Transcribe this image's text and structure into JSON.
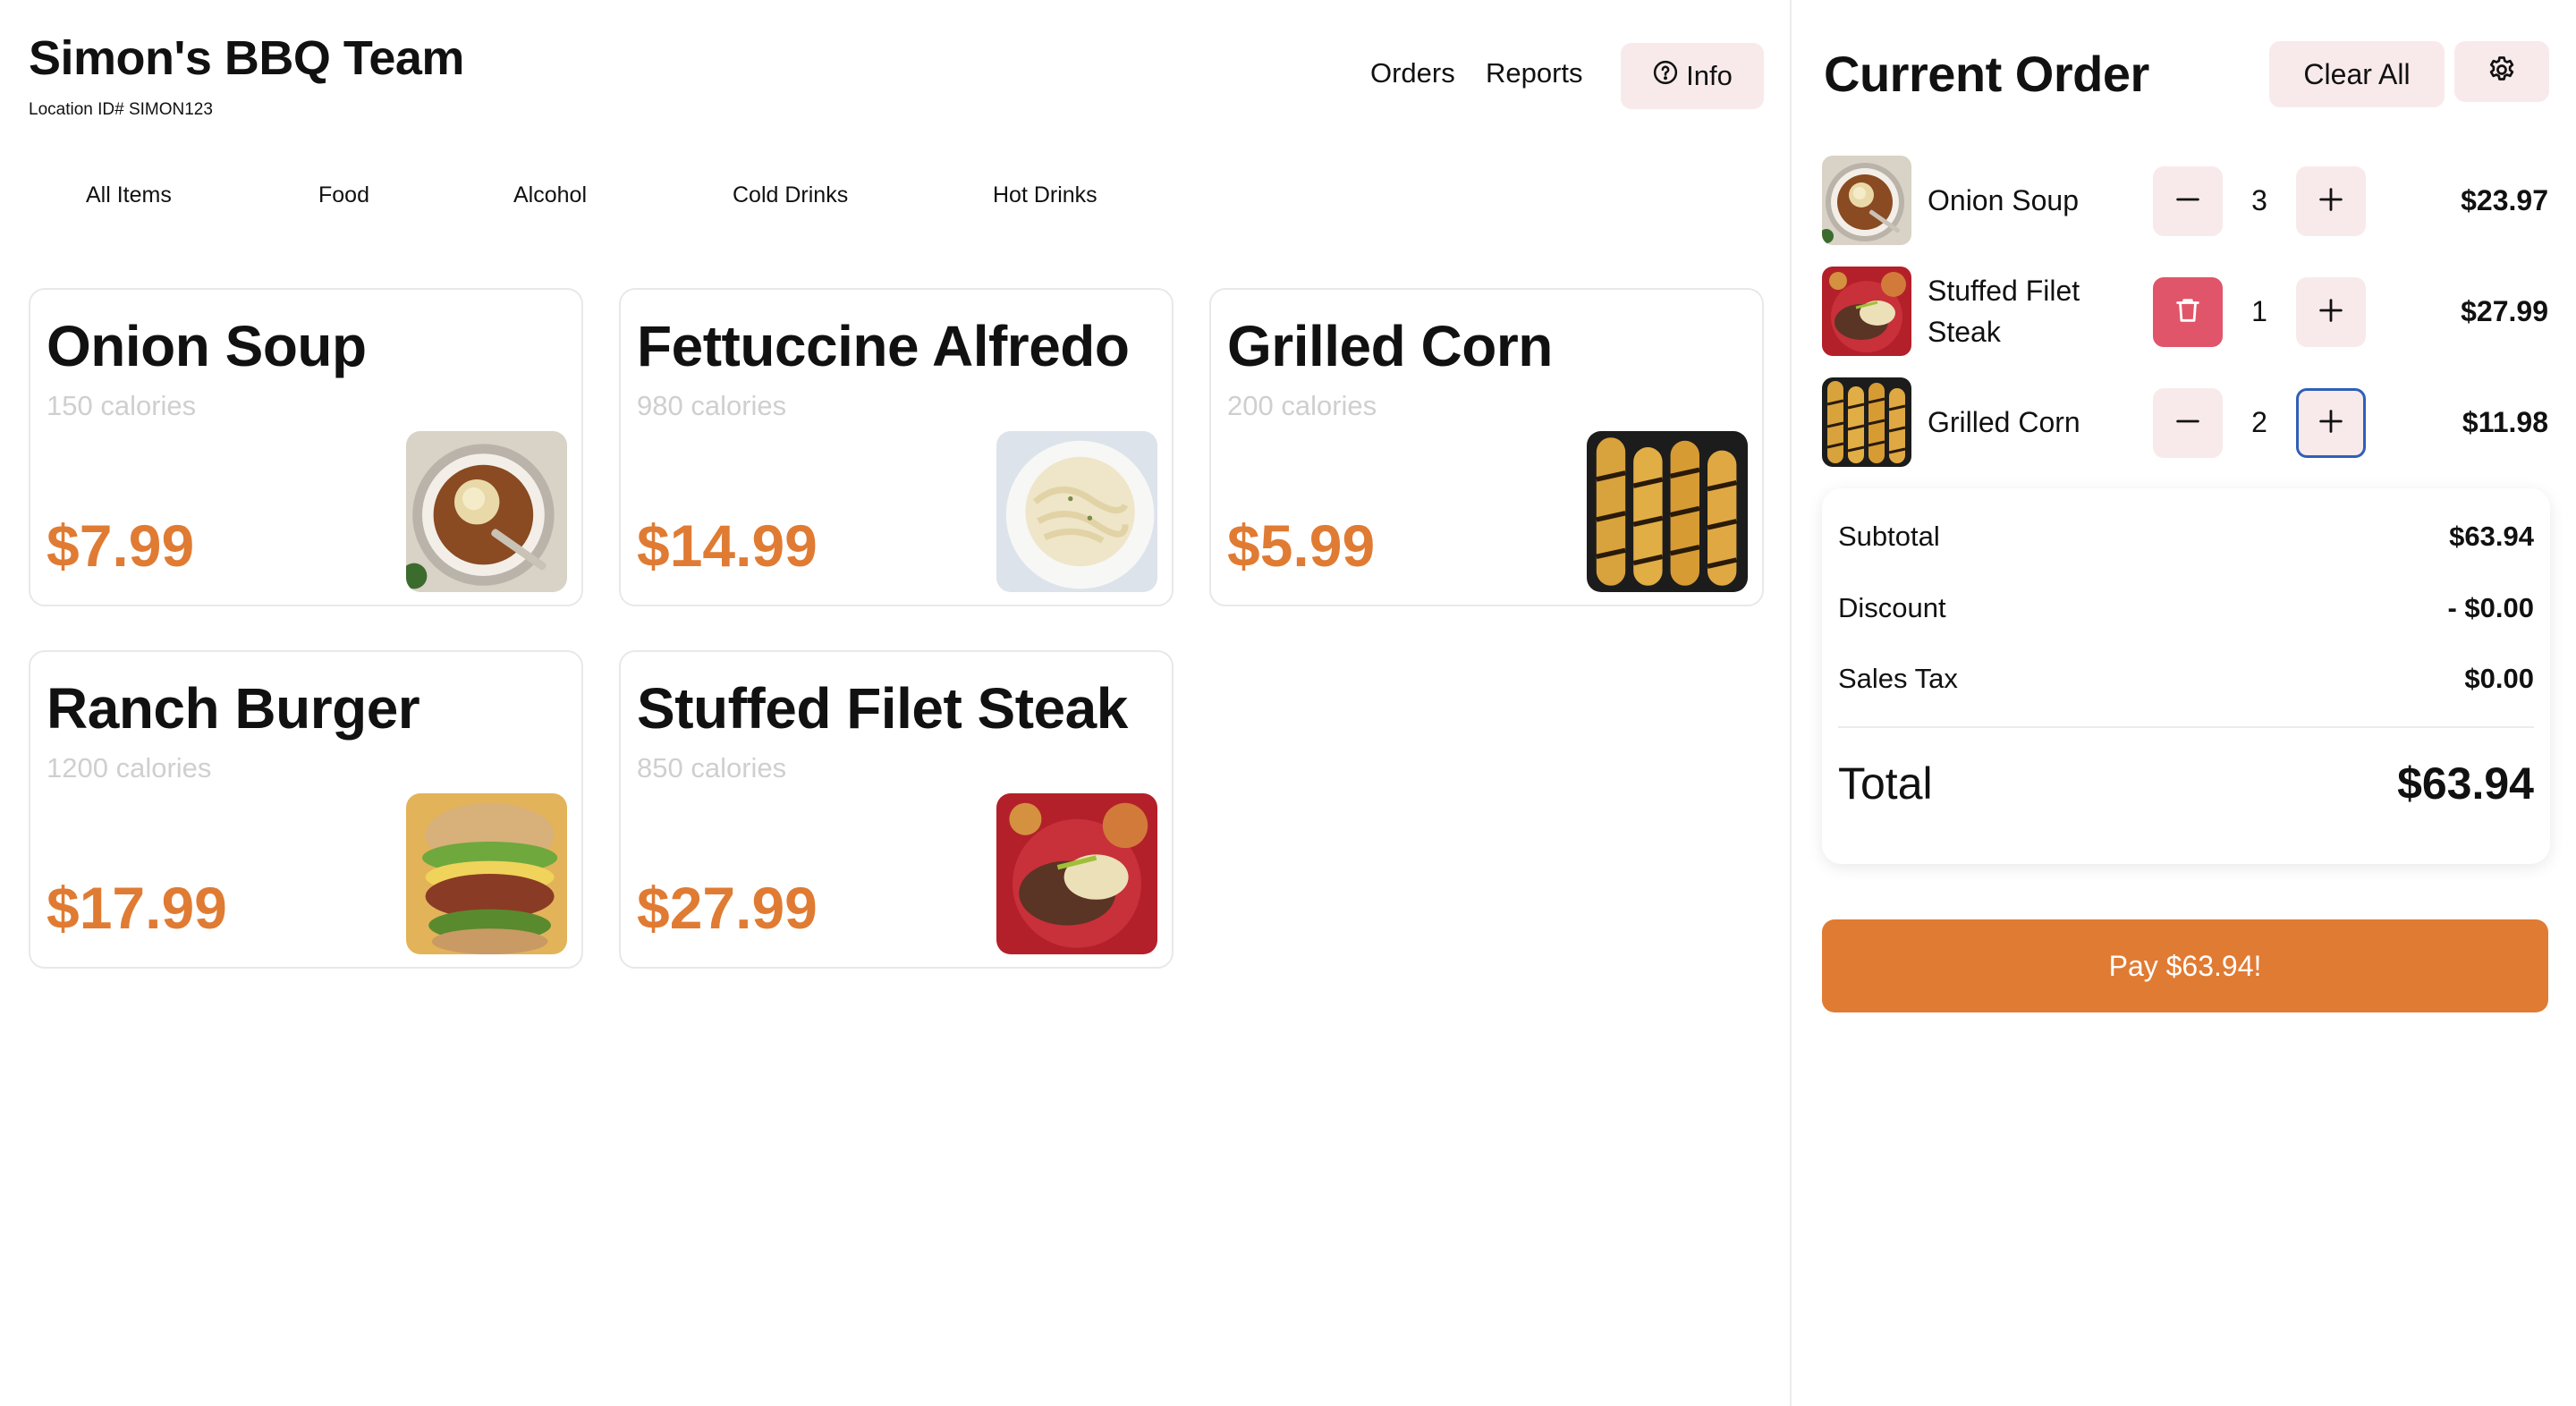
{
  "header": {
    "title": "Simon's BBQ Team",
    "location": "Location ID# SIMON123",
    "nav": {
      "orders": "Orders",
      "reports": "Reports",
      "info": "Info"
    }
  },
  "categories": [
    "All Items",
    "Food",
    "Alcohol",
    "Cold Drinks",
    "Hot Drinks"
  ],
  "menu": [
    {
      "name": "Onion Soup",
      "calories": "150 calories",
      "price": "$7.99",
      "image": "onion-soup-photo"
    },
    {
      "name": "Fettuccine Alfredo",
      "calories": "980 calories",
      "price": "$14.99",
      "image": "fettuccine-photo"
    },
    {
      "name": "Grilled Corn",
      "calories": "200 calories",
      "price": "$5.99",
      "image": "grilled-corn-photo"
    },
    {
      "name": "Ranch Burger",
      "calories": "1200 calories",
      "price": "$17.99",
      "image": "ranch-burger-photo"
    },
    {
      "name": "Stuffed Filet Steak",
      "calories": "850 calories",
      "price": "$27.99",
      "image": "filet-steak-photo"
    }
  ],
  "order": {
    "title": "Current Order",
    "clear_label": "Clear All",
    "items": [
      {
        "name": "Onion Soup",
        "qty": "3",
        "price": "$23.97",
        "left_control": "minus-icon"
      },
      {
        "name": "Stuffed Filet Steak",
        "qty": "1",
        "price": "$27.99",
        "left_control": "trash-icon"
      },
      {
        "name": "Grilled Corn",
        "qty": "2",
        "price": "$11.98",
        "left_control": "minus-icon"
      }
    ],
    "summary": {
      "subtotal_label": "Subtotal",
      "subtotal": "$63.94",
      "discount_label": "Discount",
      "discount": "- $0.00",
      "tax_label": "Sales Tax",
      "tax": "$0.00",
      "total_label": "Total",
      "total": "$63.94"
    },
    "pay_label": "Pay $63.94!"
  },
  "colors": {
    "accent": "#e07b33",
    "button_bg": "#f8eaeb",
    "danger": "#e0556a",
    "muted_text": "#cfcfcf",
    "focus_ring": "#2f5fb8"
  }
}
